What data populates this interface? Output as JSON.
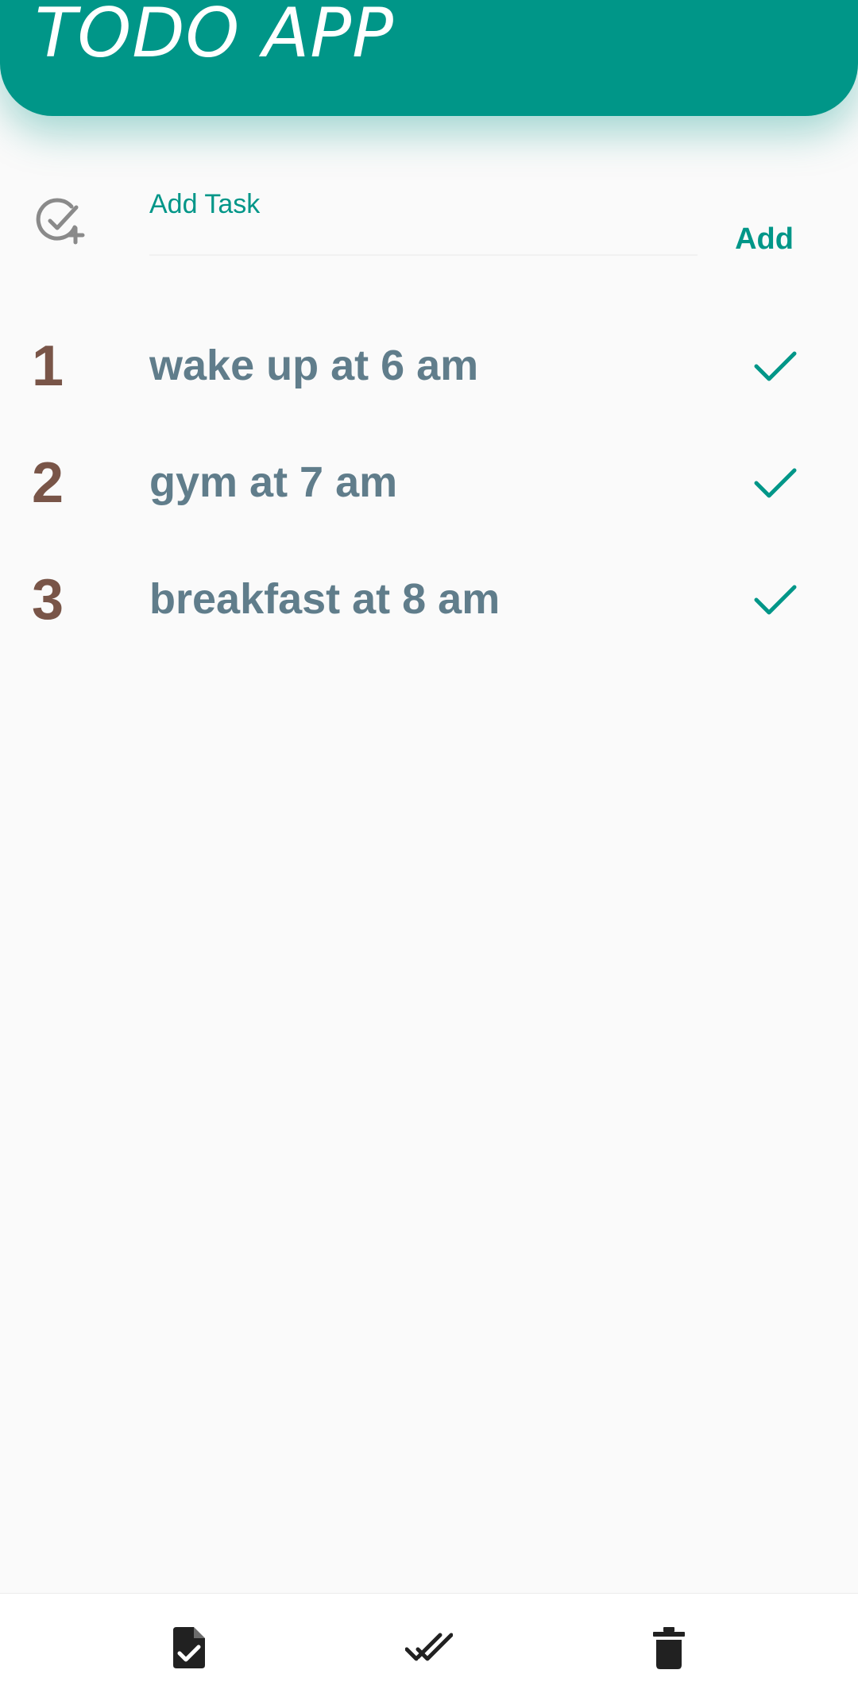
{
  "header": {
    "title": "TODO APP",
    "color": "#009688"
  },
  "add_task": {
    "field_label": "Add Task",
    "button_label": "Add",
    "icon": "add-task-icon"
  },
  "tasks": [
    {
      "number": "1",
      "text": " wake up at 6 am",
      "icon": "check-icon"
    },
    {
      "number": "2",
      "text": "gym at 7 am",
      "icon": "check-icon"
    },
    {
      "number": "3",
      "text": "breakfast at 8 am",
      "icon": "check-icon"
    }
  ],
  "bottom_nav": [
    {
      "name": "tasks-file-icon"
    },
    {
      "name": "done-all-icon"
    },
    {
      "name": "delete-icon"
    }
  ],
  "colors": {
    "accent": "#009688",
    "number": "#795548",
    "task_text": "#607d8b",
    "icon_dark": "#212121",
    "background": "#fafafa"
  }
}
